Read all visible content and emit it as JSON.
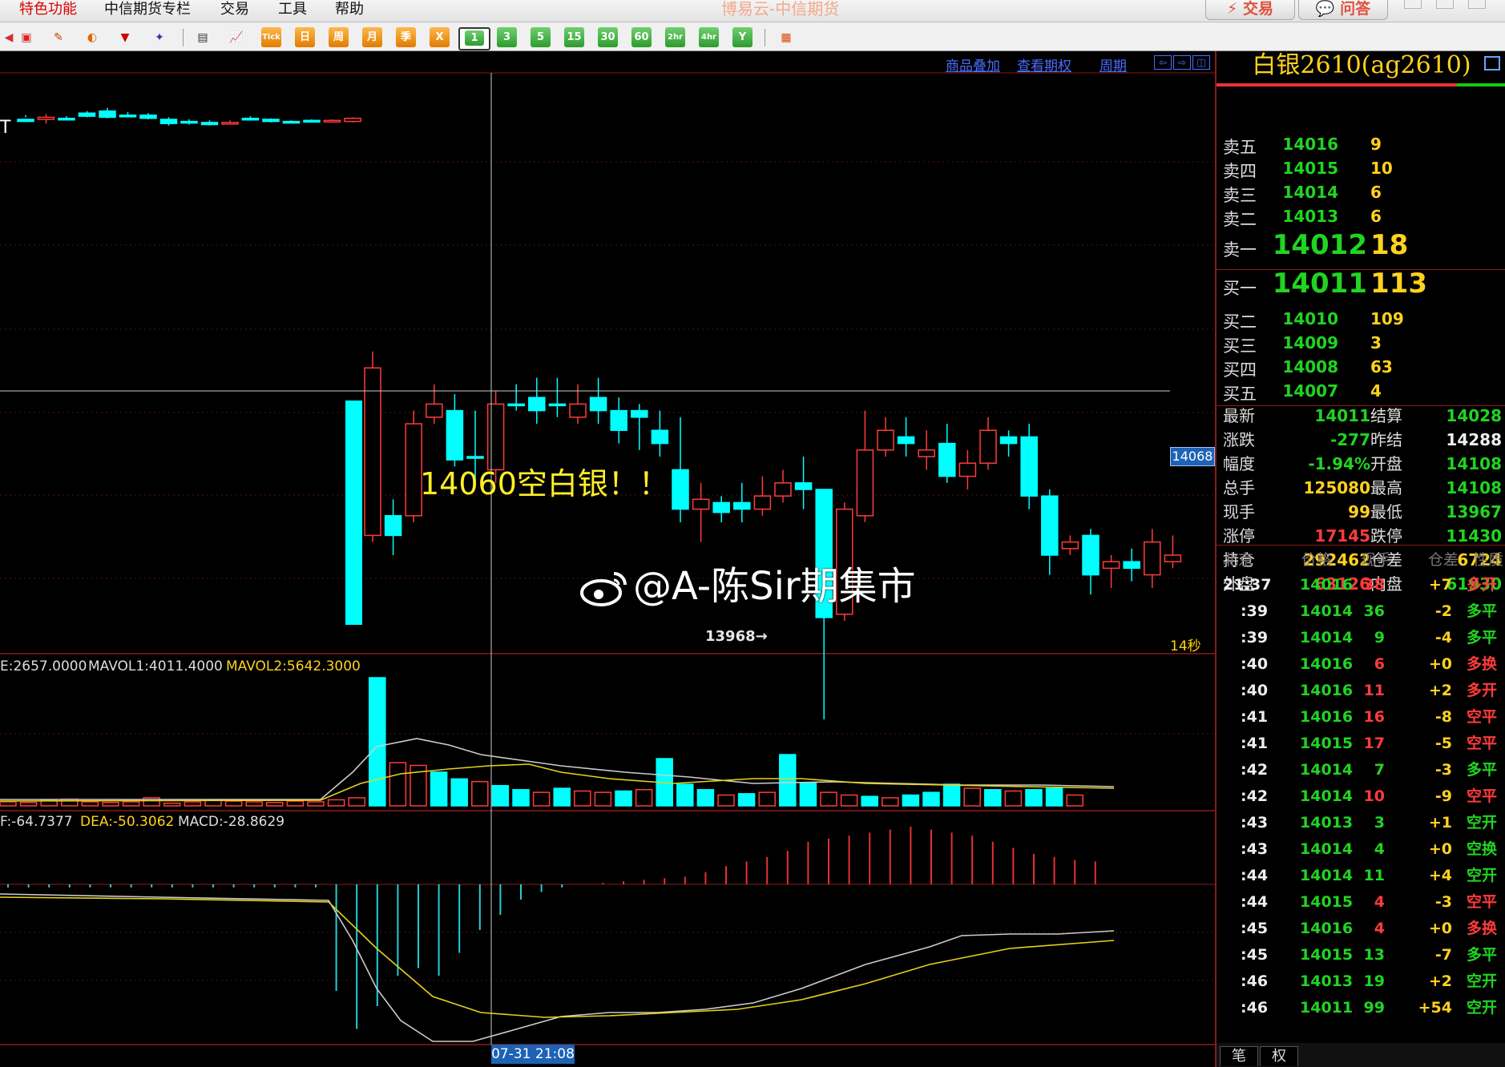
{
  "window": {
    "title": "博易云-中信期货",
    "trade_button": "交易",
    "ask_button": "问答"
  },
  "menu": [
    "特色功能",
    "中信期货专栏",
    "交易",
    "工具",
    "帮助"
  ],
  "toolbar": {
    "periods": [
      "Tick",
      "日",
      "周",
      "月",
      "季",
      "X",
      "1",
      "3",
      "5",
      "15",
      "30",
      "60",
      "2hr",
      "4hr",
      "Y"
    ],
    "active_period": "1"
  },
  "chart_header": {
    "overlay_link": "商品叠加",
    "options_link": "查看期权",
    "period_link": "周期"
  },
  "indicators": {
    "volume_label": "E:2657.0000",
    "mavol1_label": "MAVOL1:4011.4000",
    "mavol2_label": "MAVOL2:5642.3000",
    "dif_label": "F:-64.7377",
    "dea_label": "DEA:-50.3062",
    "macd_label": "MACD:-28.8629"
  },
  "overlays": {
    "annotation": "14060空白银！！",
    "crosshair_price": "14068",
    "low_label": "13968→",
    "timer": "14秒",
    "crosshair_time": "07-31 21:08",
    "watermark": "@A-陈Sir期集市",
    "partial_text": "T"
  },
  "contract": {
    "title": "白银2610(ag2610)"
  },
  "order_book": {
    "asks": [
      {
        "label": "卖五",
        "price": "14016",
        "qty": "9"
      },
      {
        "label": "卖四",
        "price": "14015",
        "qty": "10"
      },
      {
        "label": "卖三",
        "price": "14014",
        "qty": "6"
      },
      {
        "label": "卖二",
        "price": "14013",
        "qty": "6"
      },
      {
        "label": "卖一",
        "price": "14012",
        "qty": "18"
      }
    ],
    "bids": [
      {
        "label": "买一",
        "price": "14011",
        "qty": "113"
      },
      {
        "label": "买二",
        "price": "14010",
        "qty": "109"
      },
      {
        "label": "买三",
        "price": "14009",
        "qty": "3"
      },
      {
        "label": "买四",
        "price": "14008",
        "qty": "63"
      },
      {
        "label": "买五",
        "price": "14007",
        "qty": "4"
      }
    ]
  },
  "stats": [
    {
      "l1": "最新",
      "v1": "14011",
      "c1": "#21d421",
      "l2": "结算",
      "v2": "14028",
      "c2": "#21d421"
    },
    {
      "l1": "涨跌",
      "v1": "-277",
      "c1": "#21d421",
      "l2": "昨结",
      "v2": "14288",
      "c2": "#eeeeee"
    },
    {
      "l1": "幅度",
      "v1": "-1.94%",
      "c1": "#21d421",
      "l2": "开盘",
      "v2": "14108",
      "c2": "#21d421"
    },
    {
      "l1": "总手",
      "v1": "125080",
      "c1": "#ffd21f",
      "l2": "最高",
      "v2": "14108",
      "c2": "#21d421"
    },
    {
      "l1": "现手",
      "v1": "99",
      "c1": "#ffd21f",
      "l2": "最低",
      "v2": "13967",
      "c2": "#21d421"
    },
    {
      "l1": "涨停",
      "v1": "17145",
      "c1": "#ff3b3b",
      "l2": "跌停",
      "v2": "11430",
      "c2": "#21d421"
    },
    {
      "l1": "持仓",
      "v1": "292462",
      "c1": "#ffd21f",
      "l2": "仓差",
      "v2": "6724",
      "c2": "#ffd21f"
    },
    {
      "l1": "外盘",
      "v1": "63126",
      "c1": "#ff3b3b",
      "l2": "内盘",
      "v2": "61930",
      "c2": "#21d421"
    }
  ],
  "ticks_header": {
    "time": "北京",
    "price": "价格",
    "qty": "现手",
    "oi": "仓差",
    "nature": "性质"
  },
  "ticks": [
    {
      "time": "21:37",
      "price": "14016",
      "qty": "38",
      "oi": "+7",
      "nature": "多开",
      "nc": "#ff3b3b"
    },
    {
      "time": ":39",
      "price": "14014",
      "qty": "36",
      "oi": "-2",
      "nature": "多平",
      "nc": "#21d421"
    },
    {
      "time": ":39",
      "price": "14014",
      "qty": "9",
      "oi": "-4",
      "nature": "多平",
      "nc": "#21d421"
    },
    {
      "time": ":40",
      "price": "14016",
      "qty": "6",
      "oi": "+0",
      "nature": "多换",
      "nc": "#ff3b3b"
    },
    {
      "time": ":40",
      "price": "14016",
      "qty": "11",
      "oi": "+2",
      "nature": "多开",
      "nc": "#ff3b3b"
    },
    {
      "time": ":41",
      "price": "14016",
      "qty": "16",
      "oi": "-8",
      "nature": "空平",
      "nc": "#ff3b3b"
    },
    {
      "time": ":41",
      "price": "14015",
      "qty": "17",
      "oi": "-5",
      "nature": "空平",
      "nc": "#ff3b3b"
    },
    {
      "time": ":42",
      "price": "14014",
      "qty": "7",
      "oi": "-3",
      "nature": "多平",
      "nc": "#21d421"
    },
    {
      "time": ":42",
      "price": "14014",
      "qty": "10",
      "oi": "-9",
      "nature": "空平",
      "nc": "#ff3b3b"
    },
    {
      "time": ":43",
      "price": "14013",
      "qty": "3",
      "oi": "+1",
      "nature": "空开",
      "nc": "#21d421"
    },
    {
      "time": ":43",
      "price": "14014",
      "qty": "4",
      "oi": "+0",
      "nature": "空换",
      "nc": "#21d421"
    },
    {
      "time": ":44",
      "price": "14014",
      "qty": "11",
      "oi": "+4",
      "nature": "空开",
      "nc": "#21d421"
    },
    {
      "time": ":44",
      "price": "14015",
      "qty": "4",
      "oi": "-3",
      "nature": "空平",
      "nc": "#ff3b3b"
    },
    {
      "time": ":45",
      "price": "14016",
      "qty": "4",
      "oi": "+0",
      "nature": "多换",
      "nc": "#ff3b3b"
    },
    {
      "time": ":45",
      "price": "14015",
      "qty": "13",
      "oi": "-7",
      "nature": "多平",
      "nc": "#21d421"
    },
    {
      "time": ":46",
      "price": "14013",
      "qty": "19",
      "oi": "+2",
      "nature": "空开",
      "nc": "#21d421"
    },
    {
      "time": ":46",
      "price": "14011",
      "qty": "99",
      "oi": "+54",
      "nature": "空开",
      "nc": "#21d421"
    }
  ],
  "tabs": {
    "ticks": "笔",
    "rights": "权"
  },
  "chart_data": {
    "type": "candlestick",
    "candles_upper": [
      [
        100,
        98,
        104,
        102
      ],
      [
        100,
        102,
        105,
        96
      ],
      [
        101,
        101,
        103,
        99
      ],
      [
        106,
        103,
        108,
        102
      ],
      [
        108,
        102,
        111,
        101
      ],
      [
        104,
        104,
        107,
        102
      ],
      [
        104,
        101,
        106,
        100
      ],
      [
        100,
        96,
        102,
        94
      ],
      [
        98,
        97,
        100,
        95
      ],
      [
        97,
        95,
        99,
        94
      ],
      [
        96,
        97,
        99,
        95
      ],
      [
        101,
        100,
        103,
        99
      ],
      [
        100,
        98,
        101,
        97
      ],
      [
        98,
        98,
        99,
        97
      ],
      [
        99,
        98,
        100,
        97
      ],
      [
        98,
        99,
        100,
        97
      ],
      [
        98,
        101,
        102,
        97
      ]
    ],
    "candles_lower": [
      [
        14024,
        14075,
        14080,
        14022
      ],
      [
        14030,
        14024,
        14035,
        14018
      ],
      [
        14030,
        14058,
        14062,
        14028
      ],
      [
        14060,
        14064,
        14070,
        14058
      ],
      [
        14062,
        14047,
        14067,
        14045
      ],
      [
        14048,
        14048,
        14062,
        14040
      ],
      [
        14044,
        14064,
        14068,
        14040
      ],
      [
        14064,
        14064,
        14070,
        14062
      ],
      [
        14066,
        14062,
        14072,
        14058
      ],
      [
        14064,
        14064,
        14072,
        14060
      ],
      [
        14060,
        14064,
        14070,
        14058
      ],
      [
        14066,
        14062,
        14072,
        14058
      ],
      [
        14062,
        14056,
        14066,
        14052
      ],
      [
        14062,
        14060,
        14064,
        14050
      ],
      [
        14056,
        14052,
        14062,
        14048
      ],
      [
        14044,
        14032,
        14060,
        14028
      ],
      [
        14032,
        14035,
        14040,
        14022
      ],
      [
        14034,
        14031,
        14036,
        14028
      ],
      [
        14034,
        14032,
        14040,
        14028
      ],
      [
        14032,
        14036,
        14042,
        14030
      ],
      [
        14036,
        14040,
        14044,
        14034
      ],
      [
        14040,
        14038,
        14048,
        14032
      ],
      [
        14038,
        13999,
        14038,
        13968
      ],
      [
        14000,
        14032,
        14034,
        13998
      ],
      [
        14030,
        14050,
        14062,
        14028
      ],
      [
        14050,
        14056,
        14060,
        14048
      ],
      [
        14054,
        14052,
        14060,
        14048
      ],
      [
        14048,
        14050,
        14056,
        14044
      ],
      [
        14052,
        14042,
        14058,
        14040
      ],
      [
        14042,
        14046,
        14050,
        14038
      ],
      [
        14046,
        14056,
        14060,
        14044
      ],
      [
        14054,
        14052,
        14056,
        14048
      ],
      [
        14054,
        14036,
        14058,
        14032
      ],
      [
        14036,
        14018,
        14038,
        14012
      ],
      [
        14020,
        14022,
        14024,
        14018
      ],
      [
        14024,
        14012,
        14026,
        14006
      ],
      [
        14014,
        14016,
        14018,
        14008
      ],
      [
        14016,
        14014,
        14020,
        14010
      ],
      [
        14012,
        14022,
        14026,
        14008
      ],
      [
        14016,
        14018,
        14024,
        14014
      ]
    ],
    "volume": [
      300,
      250,
      400,
      500,
      300,
      250,
      300,
      600,
      200,
      300,
      400,
      350,
      300,
      250,
      350,
      300,
      450,
      600,
      9500,
      3200,
      3000,
      2500,
      2000,
      1800,
      1500,
      1200,
      1000,
      1300,
      1100,
      1000,
      1100,
      1200,
      3500,
      1600,
      1200,
      800,
      900,
      1000,
      3800,
      1700,
      1000,
      800,
      700,
      600,
      800,
      1000,
      1600,
      1300,
      1200,
      1100,
      1200,
      1300,
      800
    ],
    "macd_hist": [
      -2,
      -2,
      -2,
      -2,
      -2,
      -2,
      -2,
      -2,
      -2,
      -2,
      -2,
      -2,
      -2,
      -2,
      -2,
      -2,
      -70,
      -95,
      -80,
      -60,
      -55,
      -60,
      -45,
      -30,
      -20,
      -10,
      -5,
      -2,
      0,
      1,
      2,
      3,
      4,
      5,
      8,
      12,
      15,
      18,
      22,
      28,
      30,
      32,
      34,
      36,
      38,
      36,
      34,
      32,
      28,
      24,
      20,
      18,
      16,
      15
    ]
  }
}
